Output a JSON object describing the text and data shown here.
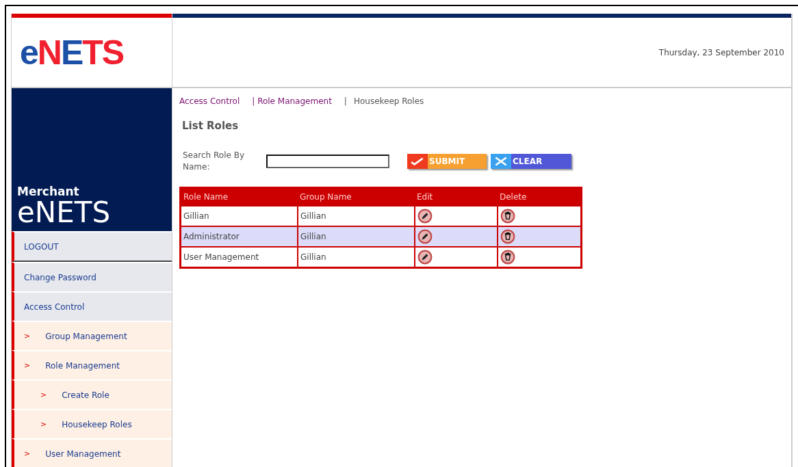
{
  "logo": {
    "parts": [
      {
        "text": "e",
        "color": "#1c4fa6"
      },
      {
        "text": "N",
        "color": "#f0202e"
      },
      {
        "text": "E",
        "color": "#1c4fa6"
      },
      {
        "text": "TS",
        "color": "#f0202e"
      }
    ]
  },
  "date": "Thursday, 23 September 2010",
  "sidebar": {
    "brand_small": "Merchant",
    "brand_large": "eNETS",
    "items": [
      {
        "label": "LOGOUT"
      },
      {
        "label": "Change Password"
      },
      {
        "label": "Access Control",
        "children": [
          {
            "label": "Group Management",
            "marker": ">"
          },
          {
            "label": "Role Management",
            "marker": ">",
            "children": [
              {
                "label": "Create Role",
                "marker": ">"
              },
              {
                "label": "Housekeep Roles",
                "marker": ">"
              }
            ]
          },
          {
            "label": "User Management",
            "marker": ">"
          }
        ]
      }
    ]
  },
  "breadcrumb": [
    {
      "label": "Access Control",
      "link": true
    },
    {
      "label": "| Role Management",
      "link": true
    },
    {
      "label": "|",
      "link": false
    },
    {
      "label": "Housekeep Roles",
      "link": false
    }
  ],
  "heading": "List Roles",
  "search": {
    "label": "Search Role By Name:"
  },
  "buttons": [
    {
      "label": "SUBMIT",
      "kind": "submit"
    },
    {
      "label": "CLEAR",
      "kind": "clear"
    }
  ],
  "table": {
    "columns": [
      "Role Name",
      "Group Name",
      "Edit",
      "Delete"
    ],
    "rows": [
      {
        "role": "Gillian",
        "group": "Gillian",
        "selected": false
      },
      {
        "role": "Administrator",
        "group": "Gillian",
        "selected": true
      },
      {
        "role": "User Management",
        "group": "Gillian",
        "selected": false
      }
    ]
  }
}
